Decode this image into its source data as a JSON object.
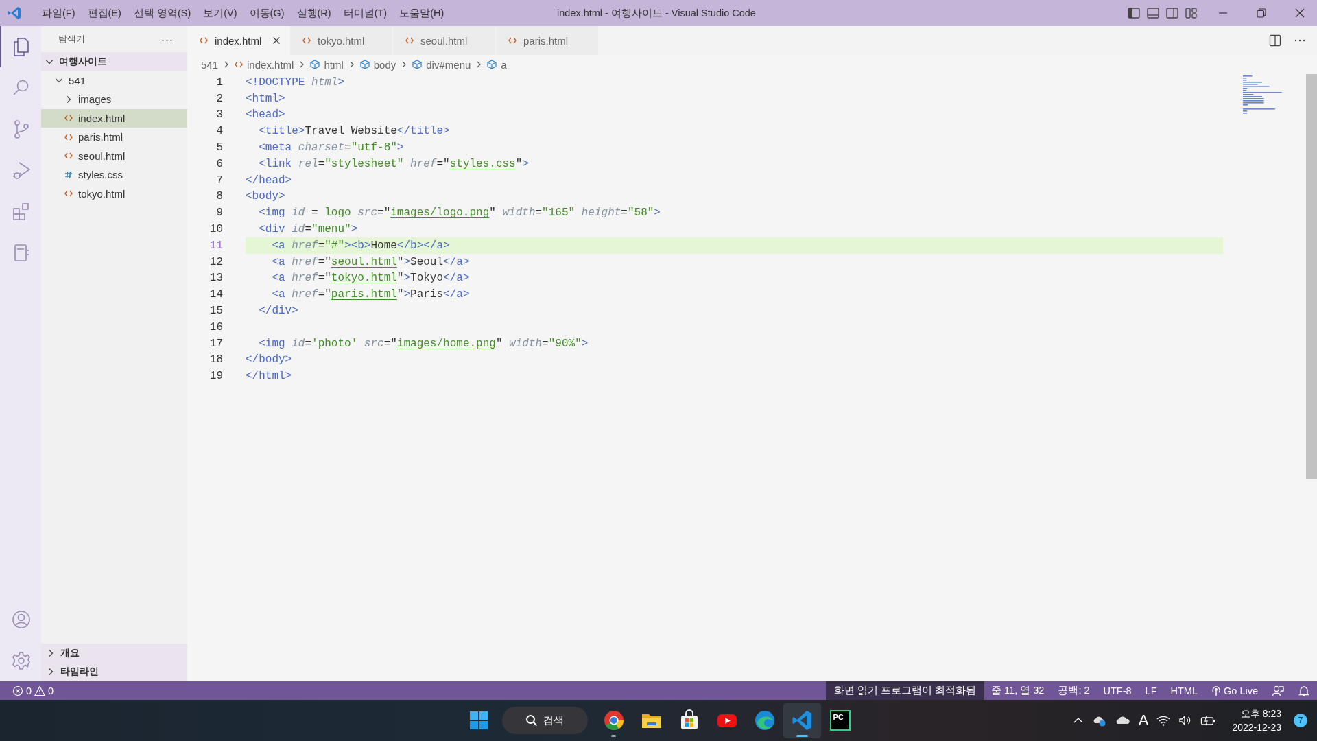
{
  "window": {
    "title": "index.html - 여행사이트 - Visual Studio Code"
  },
  "menu": [
    "파일(F)",
    "편집(E)",
    "선택 영역(S)",
    "보기(V)",
    "이동(G)",
    "실행(R)",
    "터미널(T)",
    "도움말(H)"
  ],
  "activity_bar": [
    {
      "kind": "explorer",
      "selected": true
    },
    {
      "kind": "search",
      "selected": false
    },
    {
      "kind": "source-control",
      "selected": false
    },
    {
      "kind": "run",
      "selected": false
    },
    {
      "kind": "extensions",
      "selected": false
    },
    {
      "kind": "notebook",
      "selected": false
    }
  ],
  "sidebar": {
    "title": "탐색기",
    "more": "···",
    "tree": [
      {
        "label": "여행사이트",
        "kind": "root",
        "expanded": true,
        "children": [
          {
            "label": "541",
            "kind": "folder",
            "expanded": true,
            "children": [
              {
                "label": "images",
                "kind": "folder",
                "expanded": false,
                "selected": false
              },
              {
                "label": "index.html",
                "kind": "html",
                "selected": true
              },
              {
                "label": "paris.html",
                "kind": "html",
                "selected": false
              },
              {
                "label": "seoul.html",
                "kind": "html",
                "selected": false
              },
              {
                "label": "styles.css",
                "kind": "css",
                "selected": false
              },
              {
                "label": "tokyo.html",
                "kind": "html",
                "selected": false
              }
            ]
          }
        ]
      }
    ],
    "sections": [
      {
        "label": "개요",
        "expanded": false
      },
      {
        "label": "타임라인",
        "expanded": false
      }
    ]
  },
  "tabs": [
    {
      "label": "index.html",
      "selected": true
    },
    {
      "label": "tokyo.html",
      "selected": false
    },
    {
      "label": "seoul.html",
      "selected": false
    },
    {
      "label": "paris.html",
      "selected": false
    }
  ],
  "breadcrumb": [
    {
      "label": "541",
      "kind": "folder"
    },
    {
      "label": "index.html",
      "kind": "file"
    },
    {
      "label": "html",
      "kind": "element"
    },
    {
      "label": "body",
      "kind": "element"
    },
    {
      "label": "div#menu",
      "kind": "element"
    },
    {
      "label": "a",
      "kind": "element"
    }
  ],
  "code": [
    {
      "number": "1",
      "current": false,
      "tokens": [
        {
          "kind": "tag",
          "text": "<!DOCTYPE"
        },
        {
          "kind": "attr",
          "text": " html"
        },
        {
          "kind": "tag",
          "text": ">"
        }
      ]
    },
    {
      "number": "2",
      "current": false,
      "tokens": [
        {
          "kind": "tag",
          "text": "<html>"
        }
      ]
    },
    {
      "number": "3",
      "current": false,
      "tokens": [
        {
          "kind": "tag",
          "text": "<head>"
        }
      ]
    },
    {
      "number": "4",
      "current": false,
      "tokens": [
        {
          "kind": "tag",
          "text": "  <title>"
        },
        {
          "kind": "text",
          "text": "Travel Website"
        },
        {
          "kind": "tag",
          "text": "</title>"
        }
      ]
    },
    {
      "number": "5",
      "current": false,
      "tokens": [
        {
          "kind": "tag",
          "text": "  <meta"
        },
        {
          "kind": "attr",
          "text": " charset"
        },
        {
          "kind": "op",
          "text": "="
        },
        {
          "kind": "str",
          "text": "\"utf-8\""
        },
        {
          "kind": "tag",
          "text": ">"
        }
      ]
    },
    {
      "number": "6",
      "current": false,
      "tokens": [
        {
          "kind": "tag",
          "text": "  <link"
        },
        {
          "kind": "attr",
          "text": " rel"
        },
        {
          "kind": "op",
          "text": "="
        },
        {
          "kind": "str",
          "text": "\"stylesheet\""
        },
        {
          "kind": "attr",
          "text": " href"
        },
        {
          "kind": "op",
          "text": "=\""
        },
        {
          "kind": "link",
          "text": "styles.css"
        },
        {
          "kind": "op",
          "text": "\""
        },
        {
          "kind": "tag",
          "text": ">"
        }
      ]
    },
    {
      "number": "7",
      "current": false,
      "tokens": [
        {
          "kind": "tag",
          "text": "</head>"
        }
      ]
    },
    {
      "number": "8",
      "current": false,
      "tokens": [
        {
          "kind": "tag",
          "text": "<body>"
        }
      ]
    },
    {
      "number": "9",
      "current": false,
      "tokens": [
        {
          "kind": "tag",
          "text": "  <img"
        },
        {
          "kind": "attr",
          "text": " id"
        },
        {
          "kind": "op",
          "text": " = "
        },
        {
          "kind": "str",
          "text": "logo"
        },
        {
          "kind": "attr",
          "text": " src"
        },
        {
          "kind": "op",
          "text": "=\""
        },
        {
          "kind": "link",
          "text": "images/logo.png"
        },
        {
          "kind": "op",
          "text": "\""
        },
        {
          "kind": "attr",
          "text": " width"
        },
        {
          "kind": "op",
          "text": "="
        },
        {
          "kind": "str",
          "text": "\"165\""
        },
        {
          "kind": "attr",
          "text": " height"
        },
        {
          "kind": "op",
          "text": "="
        },
        {
          "kind": "str",
          "text": "\"58\""
        },
        {
          "kind": "tag",
          "text": ">"
        }
      ]
    },
    {
      "number": "10",
      "current": false,
      "tokens": [
        {
          "kind": "tag",
          "text": "  <div"
        },
        {
          "kind": "attr",
          "text": " id"
        },
        {
          "kind": "op",
          "text": "="
        },
        {
          "kind": "str",
          "text": "\"menu\""
        },
        {
          "kind": "tag",
          "text": ">"
        }
      ]
    },
    {
      "number": "11",
      "current": true,
      "tokens": [
        {
          "kind": "tag",
          "text": "    <a"
        },
        {
          "kind": "attr",
          "text": " href"
        },
        {
          "kind": "op",
          "text": "="
        },
        {
          "kind": "str",
          "text": "\"#\""
        },
        {
          "kind": "tag",
          "text": "><b>"
        },
        {
          "kind": "text",
          "text": "Home"
        },
        {
          "kind": "tag",
          "text": "</b></a>"
        }
      ]
    },
    {
      "number": "12",
      "current": false,
      "tokens": [
        {
          "kind": "tag",
          "text": "    <a"
        },
        {
          "kind": "attr",
          "text": " href"
        },
        {
          "kind": "op",
          "text": "=\""
        },
        {
          "kind": "link",
          "text": "seoul.html"
        },
        {
          "kind": "op",
          "text": "\""
        },
        {
          "kind": "tag",
          "text": ">"
        },
        {
          "kind": "text",
          "text": "Seoul"
        },
        {
          "kind": "tag",
          "text": "</a>"
        }
      ]
    },
    {
      "number": "13",
      "current": false,
      "tokens": [
        {
          "kind": "tag",
          "text": "    <a"
        },
        {
          "kind": "attr",
          "text": " href"
        },
        {
          "kind": "op",
          "text": "=\""
        },
        {
          "kind": "link",
          "text": "tokyo.html"
        },
        {
          "kind": "op",
          "text": "\""
        },
        {
          "kind": "tag",
          "text": ">"
        },
        {
          "kind": "text",
          "text": "Tokyo"
        },
        {
          "kind": "tag",
          "text": "</a>"
        }
      ]
    },
    {
      "number": "14",
      "current": false,
      "tokens": [
        {
          "kind": "tag",
          "text": "    <a"
        },
        {
          "kind": "attr",
          "text": " href"
        },
        {
          "kind": "op",
          "text": "=\""
        },
        {
          "kind": "link",
          "text": "paris.html"
        },
        {
          "kind": "op",
          "text": "\""
        },
        {
          "kind": "tag",
          "text": ">"
        },
        {
          "kind": "text",
          "text": "Paris"
        },
        {
          "kind": "tag",
          "text": "</a>"
        }
      ]
    },
    {
      "number": "15",
      "current": false,
      "tokens": [
        {
          "kind": "tag",
          "text": "  </div>"
        }
      ]
    },
    {
      "number": "16",
      "current": false
    },
    {
      "number": "17",
      "current": false,
      "tokens": [
        {
          "kind": "tag",
          "text": "  <img"
        },
        {
          "kind": "attr",
          "text": " id"
        },
        {
          "kind": "op",
          "text": "="
        },
        {
          "kind": "str",
          "text": "'photo'"
        },
        {
          "kind": "attr",
          "text": " src"
        },
        {
          "kind": "op",
          "text": "=\""
        },
        {
          "kind": "link",
          "text": "images/home.png"
        },
        {
          "kind": "op",
          "text": "\""
        },
        {
          "kind": "attr",
          "text": " width"
        },
        {
          "kind": "op",
          "text": "="
        },
        {
          "kind": "str",
          "text": "\"90%\""
        },
        {
          "kind": "tag",
          "text": ">"
        }
      ]
    },
    {
      "number": "18",
      "current": false,
      "tokens": [
        {
          "kind": "tag",
          "text": "</body>"
        }
      ]
    },
    {
      "number": "19",
      "current": false,
      "tokens": [
        {
          "kind": "tag",
          "text": "</html>"
        }
      ]
    }
  ],
  "status_bar": {
    "errors": "0",
    "warnings": "0",
    "items": [
      {
        "label": "화면 읽기 프로그램이 최적화됨",
        "kind": "highlight"
      },
      {
        "label": "줄 11, 열 32",
        "kind": "plain"
      },
      {
        "label": "공백: 2",
        "kind": "plain"
      },
      {
        "label": "UTF-8",
        "kind": "plain"
      },
      {
        "label": "LF",
        "kind": "plain"
      },
      {
        "label": "HTML",
        "kind": "plain"
      },
      {
        "label": "Go Live",
        "kind": "live"
      }
    ]
  },
  "taskbar": {
    "search": "검색",
    "apps": [
      {
        "kind": "browser-ring",
        "active": false,
        "running": true
      },
      {
        "kind": "folder",
        "active": false,
        "running": false
      },
      {
        "kind": "store",
        "active": false,
        "running": false
      },
      {
        "kind": "play",
        "active": false,
        "running": false
      },
      {
        "kind": "wave",
        "active": false,
        "running": false
      },
      {
        "kind": "vscode",
        "active": true,
        "running": true
      },
      {
        "kind": "pc",
        "label": "PC",
        "active": false,
        "running": false
      }
    ],
    "ime": "A",
    "time": "오후 8:23",
    "date": "2022-12-23",
    "notifications": "7"
  }
}
